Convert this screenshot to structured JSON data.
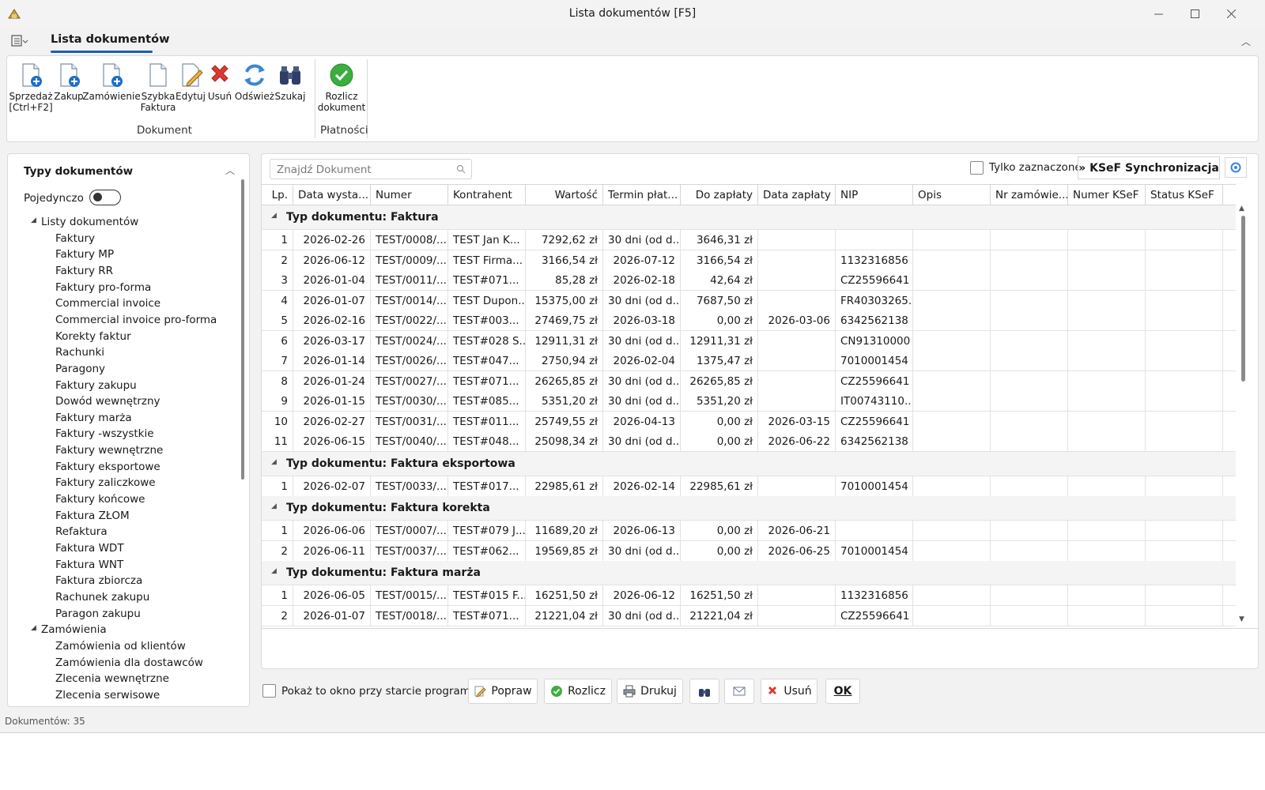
{
  "window": {
    "title": "Lista dokumentów [F5]"
  },
  "ribbon": {
    "tab": "Lista dokumentów",
    "groups": {
      "document": "Dokument",
      "payments": "Płatności"
    },
    "buttons": {
      "sale": "Sprzedaż\n[Ctrl+F2]",
      "purchase": "Zakup",
      "order": "Zamówienie",
      "quick_invoice": "Szybka\nFaktura",
      "edit": "Edytuj",
      "delete": "Usuń",
      "refresh": "Odśwież",
      "find": "Szukaj",
      "settle": "Rozlicz\ndokument"
    }
  },
  "left_panel": {
    "title": "Typy dokumentów",
    "single_label": "Pojedynczo",
    "tree": [
      {
        "label": "Listy dokumentów",
        "level": 0,
        "expanded": true
      },
      {
        "label": "Faktury",
        "level": 1
      },
      {
        "label": "Faktury MP",
        "level": 1
      },
      {
        "label": "Faktury RR",
        "level": 1
      },
      {
        "label": "Faktury pro-forma",
        "level": 1
      },
      {
        "label": "Commercial invoice",
        "level": 1
      },
      {
        "label": "Commercial invoice pro-forma",
        "level": 1
      },
      {
        "label": "Korekty faktur",
        "level": 1
      },
      {
        "label": "Rachunki",
        "level": 1
      },
      {
        "label": "Paragony",
        "level": 1
      },
      {
        "label": "Faktury zakupu",
        "level": 1
      },
      {
        "label": "Dowód wewnętrzny",
        "level": 1
      },
      {
        "label": "Faktury marża",
        "level": 1
      },
      {
        "label": "Faktury -wszystkie",
        "level": 1
      },
      {
        "label": "Faktury wewnętrzne",
        "level": 1
      },
      {
        "label": "Faktury eksportowe",
        "level": 1
      },
      {
        "label": "Faktury zaliczkowe",
        "level": 1
      },
      {
        "label": "Faktury końcowe",
        "level": 1
      },
      {
        "label": "Faktura ZŁOM",
        "level": 1
      },
      {
        "label": "Refaktura",
        "level": 1
      },
      {
        "label": "Faktura WDT",
        "level": 1
      },
      {
        "label": "Faktura WNT",
        "level": 1
      },
      {
        "label": "Faktura zbiorcza",
        "level": 1
      },
      {
        "label": "Rachunek zakupu",
        "level": 1
      },
      {
        "label": "Paragon zakupu",
        "level": 1
      },
      {
        "label": "Zamówienia",
        "level": 0,
        "expanded": true
      },
      {
        "label": "Zamówienia od klientów",
        "level": 1
      },
      {
        "label": "Zamówienia dla dostawców",
        "level": 1
      },
      {
        "label": "Zlecenia wewnętrzne",
        "level": 1
      },
      {
        "label": "Zlecenia serwisowe",
        "level": 1
      }
    ]
  },
  "toolbar": {
    "search_placeholder": "Znajdź Dokument",
    "only_selected_label": "Tylko zaznaczone",
    "ksef_sync_label": "» KSeF Synchronizacja"
  },
  "grid": {
    "columns": [
      "Lp.",
      "Data wysta...",
      "Numer",
      "Kontrahent",
      "Wartość",
      "Termin płat...",
      "Do zapłaty",
      "Data zapłaty",
      "NIP",
      "Opis",
      "Nr zamówie...",
      "Numer KSeF",
      "Status KSeF"
    ],
    "groups": [
      {
        "title": "Typ dokumentu: Faktura",
        "rows": [
          [
            "1",
            "2026-02-26",
            "TEST/0008/...",
            "TEST Jan K...",
            "7292,62 zł",
            "30 dni (od d...",
            "3646,31 zł",
            "",
            "",
            "",
            "",
            "",
            ""
          ],
          [
            "2",
            "2026-06-12",
            "TEST/0009/...",
            "TEST Firma...",
            "3166,54 zł",
            "2026-07-12",
            "3166,54 zł",
            "",
            "1132316856",
            "",
            "",
            "",
            ""
          ],
          [
            "3",
            "2026-01-04",
            "TEST/0011/...",
            "TEST#071...",
            "85,28 zł",
            "2026-02-18",
            "42,64 zł",
            "",
            "CZ25596641",
            "",
            "",
            "",
            ""
          ],
          [
            "4",
            "2026-01-07",
            "TEST/0014/...",
            "TEST Dupon...",
            "15375,00 zł",
            "30 dni (od d...",
            "7687,50 zł",
            "",
            "FR40303265...",
            "",
            "",
            "",
            ""
          ],
          [
            "5",
            "2026-02-16",
            "TEST/0022/...",
            "TEST#003...",
            "27469,75 zł",
            "2026-03-18",
            "0,00 zł",
            "2026-03-06",
            "6342562138",
            "",
            "",
            "",
            ""
          ],
          [
            "6",
            "2026-03-17",
            "TEST/0024/...",
            "TEST#028 S...",
            "12911,31 zł",
            "30 dni (od d...",
            "12911,31 zł",
            "",
            "CN91310000",
            "",
            "",
            "",
            ""
          ],
          [
            "7",
            "2026-01-14",
            "TEST/0026/...",
            "TEST#047...",
            "2750,94 zł",
            "2026-02-04",
            "1375,47 zł",
            "",
            "7010001454",
            "",
            "",
            "",
            ""
          ],
          [
            "8",
            "2026-01-24",
            "TEST/0027/...",
            "TEST#071...",
            "26265,85 zł",
            "30 dni (od d...",
            "26265,85 zł",
            "",
            "CZ25596641",
            "",
            "",
            "",
            ""
          ],
          [
            "9",
            "2026-01-15",
            "TEST/0030/...",
            "TEST#085...",
            "5351,20 zł",
            "30 dni (od d...",
            "5351,20 zł",
            "",
            "IT00743110...",
            "",
            "",
            "",
            ""
          ],
          [
            "10",
            "2026-02-27",
            "TEST/0031/...",
            "TEST#011...",
            "25749,55 zł",
            "2026-04-13",
            "0,00 zł",
            "2026-03-15",
            "CZ25596641",
            "",
            "",
            "",
            ""
          ],
          [
            "11",
            "2026-06-15",
            "TEST/0040/...",
            "TEST#048...",
            "25098,34 zł",
            "30 dni (od d...",
            "0,00 zł",
            "2026-06-22",
            "6342562138",
            "",
            "",
            "",
            ""
          ]
        ]
      },
      {
        "title": "Typ dokumentu: Faktura eksportowa",
        "rows": [
          [
            "1",
            "2026-02-07",
            "TEST/0033/...",
            "TEST#017...",
            "22985,61 zł",
            "2026-02-14",
            "22985,61 zł",
            "",
            "7010001454",
            "",
            "",
            "",
            ""
          ]
        ]
      },
      {
        "title": "Typ dokumentu: Faktura korekta",
        "rows": [
          [
            "1",
            "2026-06-06",
            "TEST/0007/...",
            "TEST#079 J...",
            "11689,20 zł",
            "2026-06-13",
            "0,00 zł",
            "2026-06-21",
            "",
            "",
            "",
            "",
            ""
          ],
          [
            "2",
            "2026-06-11",
            "TEST/0037/...",
            "TEST#062...",
            "19569,85 zł",
            "30 dni (od d...",
            "0,00 zł",
            "2026-06-25",
            "7010001454",
            "",
            "",
            "",
            ""
          ]
        ]
      },
      {
        "title": "Typ dokumentu: Faktura marża",
        "rows": [
          [
            "1",
            "2026-06-05",
            "TEST/0015/...",
            "TEST#015 F...",
            "16251,50 zł",
            "2026-06-12",
            "16251,50 zł",
            "",
            "1132316856",
            "",
            "",
            "",
            ""
          ],
          [
            "2",
            "2026-01-07",
            "TEST/0018/...",
            "TEST#071...",
            "21221,04 zł",
            "30 dni (od d...",
            "21221,04 zł",
            "",
            "CZ25596641",
            "",
            "",
            "",
            ""
          ]
        ]
      }
    ]
  },
  "bottom": {
    "show_on_start_label": "Pokaż to okno przy starcie programu",
    "fix_label": "Popraw",
    "settle_label": "Rozlicz",
    "print_label": "Drukuj",
    "delete_label": "Usuń",
    "ok_label": "OK"
  },
  "status": {
    "count_text": "Dokumentów: 35"
  },
  "colors": {
    "accent": "#1c5fa8",
    "tab_underline": "#1c5fa8",
    "delete_red": "#d93a32",
    "ok_green": "#3cae3f"
  }
}
